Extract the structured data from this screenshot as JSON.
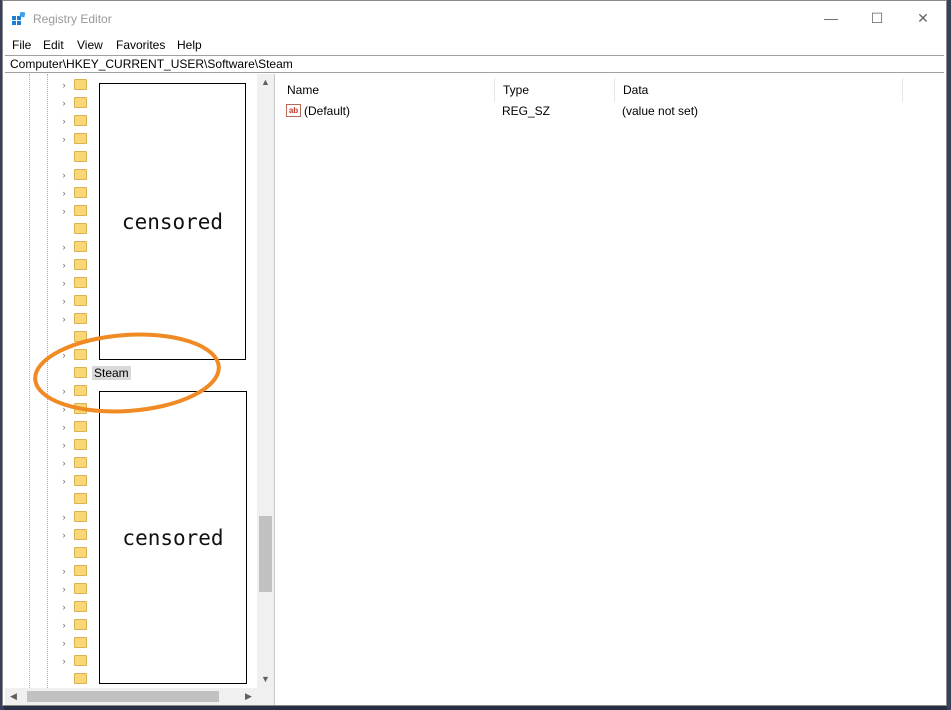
{
  "window": {
    "title": "Registry Editor",
    "minimize_glyph": "—",
    "maximize_glyph": "☐",
    "close_glyph": "✕",
    "app_icon": "registry-editor-icon"
  },
  "menu": {
    "items": [
      {
        "label": "File"
      },
      {
        "label": "Edit"
      },
      {
        "label": "View"
      },
      {
        "label": "Favorites"
      },
      {
        "label": "Help"
      }
    ]
  },
  "address_bar": {
    "path": "Computer\\HKEY_CURRENT_USER\\Software\\Steam"
  },
  "tree": {
    "selected_label": "Steam",
    "censor_top_text": "censored",
    "censor_bottom_text": "censored",
    "censored_row_count": 34,
    "selected_row_index": 16,
    "folder_color": "#f8d775",
    "selection_color": "#d9d9d9"
  },
  "values": {
    "columns": [
      {
        "label": "Name"
      },
      {
        "label": "Type"
      },
      {
        "label": "Data"
      }
    ],
    "rows": [
      {
        "name": "(Default)",
        "type": "REG_SZ",
        "data": "(value not set)",
        "icon": "ab"
      }
    ]
  },
  "annotation": {
    "color": "#f08a24",
    "shape": "ellipse"
  }
}
